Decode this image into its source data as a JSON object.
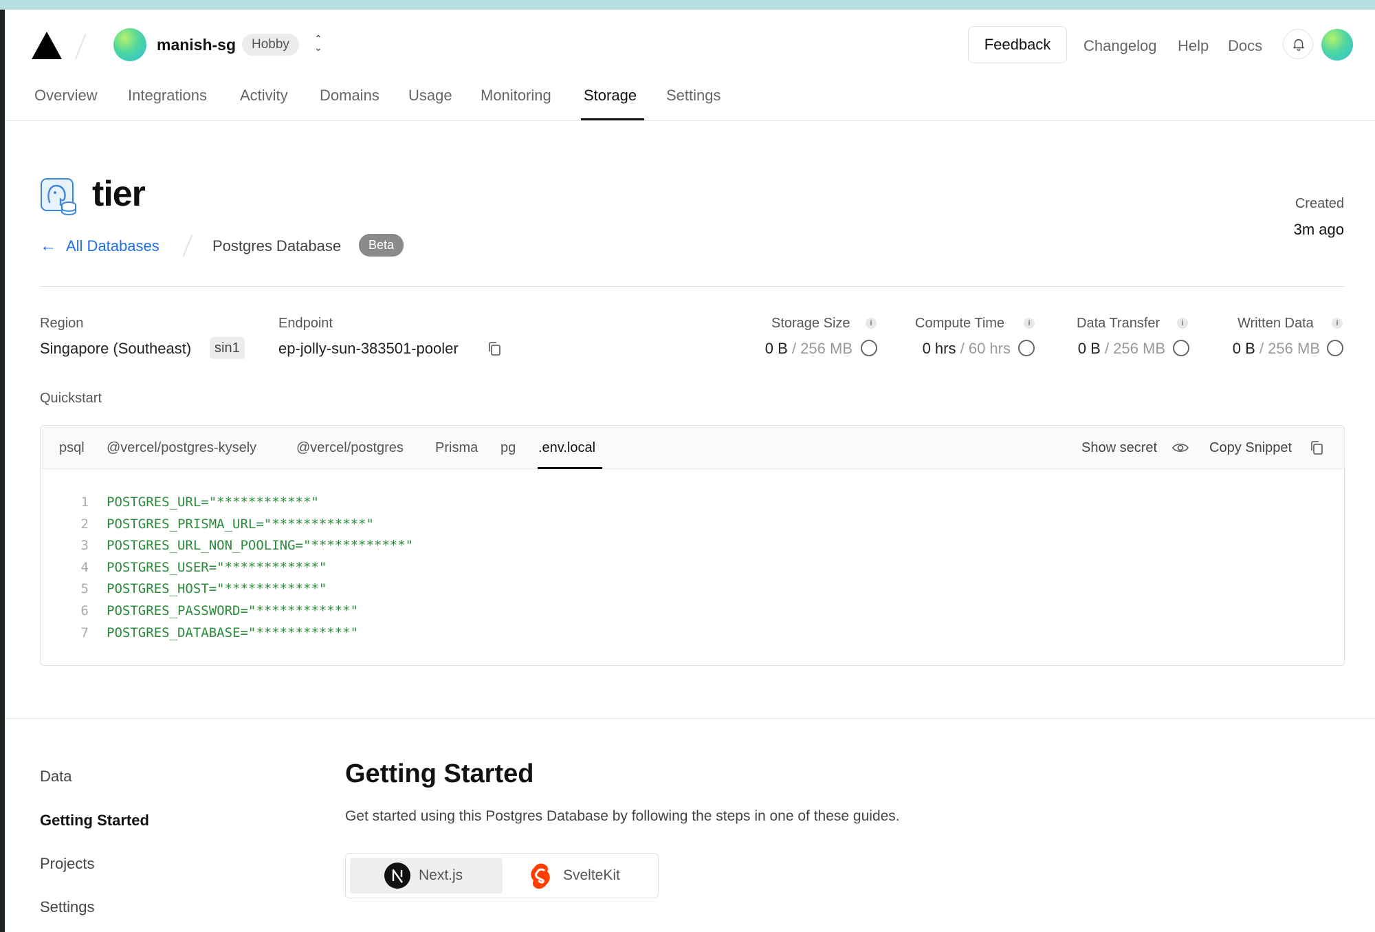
{
  "header": {
    "team_name": "manish-sg",
    "plan": "Hobby",
    "feedback": "Feedback",
    "links": [
      "Changelog",
      "Help",
      "Docs"
    ]
  },
  "nav": {
    "tabs": [
      "Overview",
      "Integrations",
      "Activity",
      "Domains",
      "Usage",
      "Monitoring",
      "Storage",
      "Settings"
    ],
    "active": "Storage"
  },
  "database": {
    "name": "tier",
    "back_link": "All Databases",
    "type": "Postgres Database",
    "badge": "Beta",
    "created_label": "Created",
    "created_value": "3m ago",
    "region_label": "Region",
    "region_value": "Singapore (Southeast)",
    "region_code": "sin1",
    "endpoint_label": "Endpoint",
    "endpoint_value": "ep-jolly-sun-383501-pooler"
  },
  "stats": [
    {
      "label": "Storage Size",
      "used": "0 B",
      "limit": "/ 256 MB",
      "fraction": 0
    },
    {
      "label": "Compute Time",
      "used": "0 hrs",
      "limit": "/ 60 hrs",
      "fraction": 0
    },
    {
      "label": "Data Transfer",
      "used": "0 B",
      "limit": "/ 256 MB",
      "fraction": 0
    },
    {
      "label": "Written Data",
      "used": "0 B",
      "limit": "/ 256 MB",
      "fraction": 0
    }
  ],
  "quickstart": {
    "label": "Quickstart",
    "tabs": [
      "psql",
      "@vercel/postgres-kysely",
      "@vercel/postgres",
      "Prisma",
      "pg",
      ".env.local"
    ],
    "active_tab": ".env.local",
    "show_secret": "Show secret",
    "copy_snippet": "Copy Snippet",
    "lines": [
      {
        "n": "1",
        "code": "POSTGRES_URL=\"************\""
      },
      {
        "n": "2",
        "code": "POSTGRES_PRISMA_URL=\"************\""
      },
      {
        "n": "3",
        "code": "POSTGRES_URL_NON_POOLING=\"************\""
      },
      {
        "n": "4",
        "code": "POSTGRES_USER=\"************\""
      },
      {
        "n": "5",
        "code": "POSTGRES_HOST=\"************\""
      },
      {
        "n": "6",
        "code": "POSTGRES_PASSWORD=\"************\""
      },
      {
        "n": "7",
        "code": "POSTGRES_DATABASE=\"************\""
      }
    ]
  },
  "sidebar": {
    "items": [
      "Data",
      "Getting Started",
      "Projects",
      "Settings"
    ],
    "active": "Getting Started"
  },
  "getting_started": {
    "title": "Getting Started",
    "description": "Get started using this Postgres Database by following the steps in one of these guides.",
    "guides": [
      {
        "label": "Next.js",
        "icon": "nextjs-icon",
        "selected": true
      },
      {
        "label": "SvelteKit",
        "icon": "sveltekit-icon",
        "selected": false
      }
    ]
  },
  "colors": {
    "accent_link": "#1d6fe6",
    "code_text": "#2a8c3a",
    "svelte": "#ff3e00"
  }
}
